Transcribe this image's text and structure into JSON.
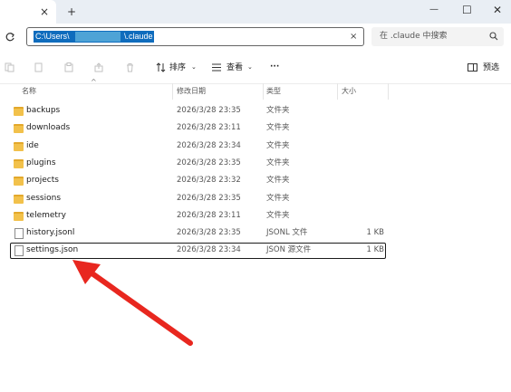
{
  "window": {
    "new_tab_icon": "+",
    "close_tab_icon": "×",
    "minimize_icon": "—",
    "maximize_icon": "☐",
    "close_icon": "✕"
  },
  "address": {
    "path_part1": "C:\\Users\\",
    "path_part2": "\\.claude",
    "search_placeholder": "在 .claude 中搜索"
  },
  "toolbar": {
    "sort_label": "排序",
    "view_label": "查看",
    "more_label": "···",
    "preview_label": "预选"
  },
  "columns": {
    "name": "名称",
    "date": "修改日期",
    "type": "类型",
    "size": "大小"
  },
  "files": [
    {
      "name": "backups",
      "date": "2026/3/28 23:35",
      "type": "文件夹",
      "size": "",
      "kind": "folder"
    },
    {
      "name": "downloads",
      "date": "2026/3/28 23:11",
      "type": "文件夹",
      "size": "",
      "kind": "folder"
    },
    {
      "name": "ide",
      "date": "2026/3/28 23:34",
      "type": "文件夹",
      "size": "",
      "kind": "folder"
    },
    {
      "name": "plugins",
      "date": "2026/3/28 23:35",
      "type": "文件夹",
      "size": "",
      "kind": "folder"
    },
    {
      "name": "projects",
      "date": "2026/3/28 23:32",
      "type": "文件夹",
      "size": "",
      "kind": "folder"
    },
    {
      "name": "sessions",
      "date": "2026/3/28 23:35",
      "type": "文件夹",
      "size": "",
      "kind": "folder"
    },
    {
      "name": "telemetry",
      "date": "2026/3/28 23:11",
      "type": "文件夹",
      "size": "",
      "kind": "folder"
    },
    {
      "name": "history.jsonl",
      "date": "2026/3/28 23:35",
      "type": "JSONL 文件",
      "size": "1 KB",
      "kind": "file"
    },
    {
      "name": "settings.json",
      "date": "2026/3/28 23:34",
      "type": "JSON 源文件",
      "size": "1 KB",
      "kind": "file"
    }
  ],
  "colors": {
    "accent": "#0f6cbd",
    "arrow": "#e8271f",
    "folder": "#f2c14b"
  }
}
